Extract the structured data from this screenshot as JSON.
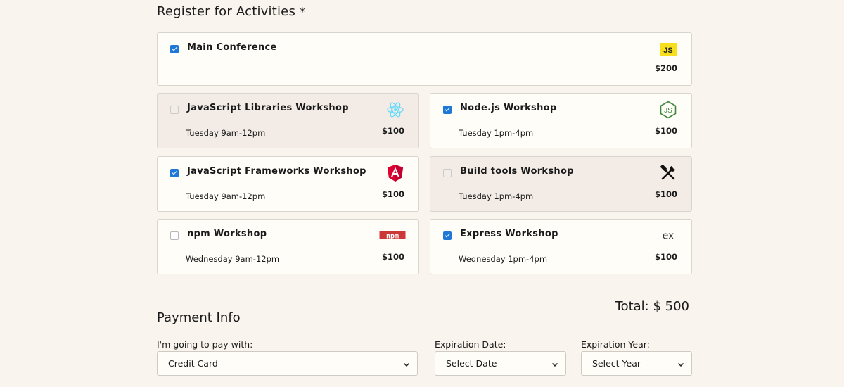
{
  "activities": {
    "heading": "Register for Activities",
    "required_mark": "*",
    "main": {
      "title": "Main Conference",
      "price": "$200",
      "checked": true,
      "logo": "js-logo-icon"
    },
    "workshops": [
      {
        "title": "JavaScript Libraries Workshop",
        "when": "Tuesday 9am-12pm",
        "price": "$100",
        "checked": false,
        "logo": "react-icon"
      },
      {
        "title": "Node.js Workshop",
        "when": "Tuesday 1pm-4pm",
        "price": "$100",
        "checked": true,
        "logo": "nodejs-icon"
      },
      {
        "title": "JavaScript Frameworks Workshop",
        "when": "Tuesday 9am-12pm",
        "price": "$100",
        "checked": true,
        "logo": "angular-icon"
      },
      {
        "title": "Build tools Workshop",
        "when": "Tuesday 1pm-4pm",
        "price": "$100",
        "checked": false,
        "logo": "tools-icon"
      },
      {
        "title": "npm Workshop",
        "when": "Wednesday 9am-12pm",
        "price": "$100",
        "checked": false,
        "logo": "npm-icon"
      },
      {
        "title": "Express Workshop",
        "when": "Wednesday 1pm-4pm",
        "price": "$100",
        "checked": true,
        "logo": "express-icon"
      }
    ],
    "total": "Total: $ 500"
  },
  "payment": {
    "heading": "Payment Info",
    "method_label": "I'm going to pay with:",
    "method_value": "Credit Card",
    "exp_date_label": "Expiration Date:",
    "exp_date_value": "Select Date",
    "exp_year_label": "Expiration Year:",
    "exp_year_value": "Select Year"
  },
  "colors": {
    "background": "#f9f4ed",
    "checkbox_checked": "#1f78d8",
    "unchecked_card": "#f3ece6"
  }
}
